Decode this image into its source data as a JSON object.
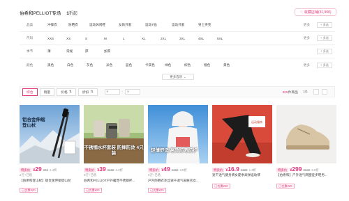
{
  "header": {
    "breadcrumb": "伯希和PELLIOT专场",
    "count_value": "1",
    "count_unit": "折起",
    "favorite_label": "收藏店铺(31,900)"
  },
  "filters": [
    {
      "label": "品类",
      "options": [
        "冲锋衣",
        "防晒衣",
        "运动休闲鞋",
        "女款外套",
        "运动T恤",
        "运动外套",
        "男士夹克"
      ],
      "more": "更多",
      "multi": "+ 多选"
    },
    {
      "label": "尺码",
      "options": [
        "XXS",
        "XS",
        "S",
        "M",
        "L",
        "XL",
        "2XL",
        "3XL",
        "4XL",
        "5XL"
      ],
      "more": "更多",
      "multi": "+ 多选"
    },
    {
      "label": "季节",
      "options": [
        "薄",
        "常规",
        "厚",
        "加厚"
      ],
      "more": "",
      "multi": "+ 多选"
    },
    {
      "label": "颜色",
      "options": [
        "黑色",
        "白色",
        "灰色",
        "米色",
        "蓝色",
        "卡其色",
        "绿色",
        "棕色",
        "橙色",
        "黄色"
      ],
      "more": "更多",
      "multi": "+ 多选"
    }
  ],
  "more_options": "更多选项",
  "sort": {
    "items": [
      "综合",
      "销量",
      "价格",
      "折扣"
    ],
    "price_from": "¥",
    "price_to": "¥",
    "range_sep": "-",
    "total_count": "209",
    "total_unit": "件商品",
    "page": "1/1"
  },
  "products": [
    {
      "tag": "特卖价",
      "price": "29",
      "orig": "¥99",
      "disc": "2.4折",
      "sold": "2万+已售",
      "title": "【伯希和登山杖】铝合金伸缩登山杖",
      "coupon": "已优惠¥20",
      "overlay": "铝合金伸缩 登山杖"
    },
    {
      "tag": "特卖价",
      "price": "39",
      "orig": "¥168",
      "disc": "2.3折",
      "sold": "9万+已售",
      "title": "伯希和PELLIOT户外露营不锈钢杯...",
      "coupon": "已优惠¥20",
      "overlay": "不锈钢水杯套装 防摔防烫 4只装"
    },
    {
      "tag": "特卖价",
      "price": "49",
      "orig": "¥169",
      "disc": "3.0折",
      "sold": "8万+已售",
      "title": "户外防晒衣冰丝速干透气皮肤衣女...",
      "coupon": "已优惠¥20",
      "overlay": "轻薄舒适 高效防晒防护"
    },
    {
      "tag": "特卖价",
      "price": "16.9",
      "orig": "¥130",
      "disc": "1.3折",
      "sold": "",
      "title": "速干透气健身裤女夏季高弹运动裤",
      "coupon": "已优惠¥20",
      "overlay": ""
    },
    {
      "tag": "特卖价",
      "price": "299",
      "orig": "¥669",
      "disc": "4.5折",
      "sold": "",
      "title": "【伯希和】户外透气网面徒步鞋男...",
      "coupon": "已优惠¥20",
      "overlay": ""
    }
  ],
  "colors": {
    "accent": "#e2347a",
    "accent_light": "#fbe3ec"
  }
}
